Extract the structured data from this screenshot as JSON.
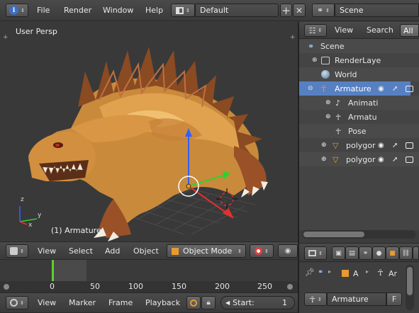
{
  "topbar": {
    "menus": [
      "File",
      "Render",
      "Window",
      "Help"
    ],
    "screen_layout": "Default",
    "scene": "Scene"
  },
  "viewport": {
    "view_label": "User Persp",
    "object_label": "(1) Armature",
    "axis_x": "x",
    "axis_y": "y",
    "axis_z": "z"
  },
  "viewport_header": {
    "menus": [
      "View",
      "Select",
      "Add",
      "Object"
    ],
    "mode": "Object Mode"
  },
  "outliner": {
    "header": {
      "view": "View",
      "search": "Search",
      "filter": "All"
    },
    "items": [
      {
        "label": "Scene"
      },
      {
        "label": "RenderLaye"
      },
      {
        "label": "World"
      },
      {
        "label": "Armature"
      },
      {
        "label": "Animati"
      },
      {
        "label": "Armatu"
      },
      {
        "label": "Pose"
      },
      {
        "label": "polygor"
      },
      {
        "label": "polygor"
      }
    ]
  },
  "properties": {
    "context_a": "A",
    "context_ar": "Ar",
    "name_field": "Armature",
    "f_button": "F"
  },
  "timeline": {
    "ticks": [
      "0",
      "50",
      "100",
      "150",
      "200",
      "250"
    ],
    "current_frame": 0,
    "menus": [
      "View",
      "Marker",
      "Frame",
      "Playback"
    ],
    "start_label": "Start:",
    "start_value": "1"
  },
  "colors": {
    "viewport_bg": "#393939",
    "selected_row": "#5680c2",
    "playhead": "#60d030",
    "x_axis": "#e03030",
    "y_axis": "#30d030",
    "z_axis": "#3060ff"
  }
}
